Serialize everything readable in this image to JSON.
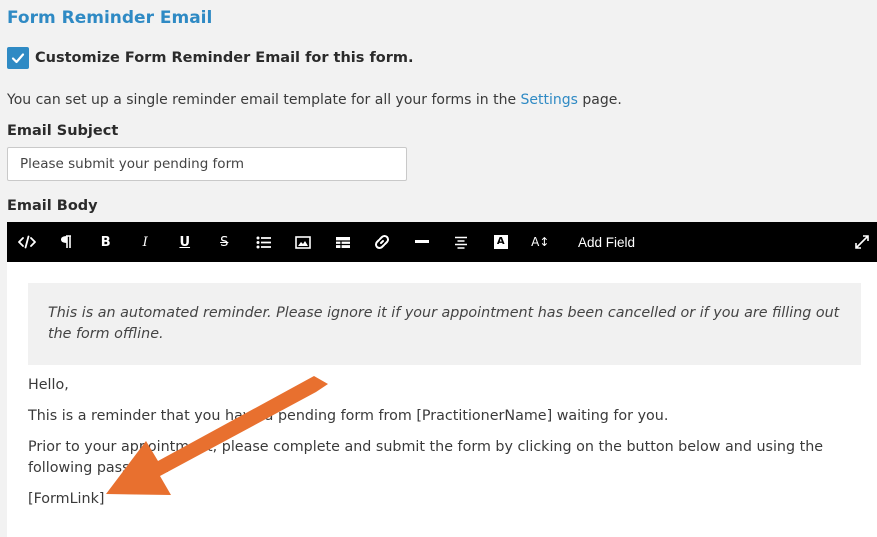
{
  "header": {
    "title": "Form Reminder Email",
    "customize_label": "Customize Form Reminder Email for this form.",
    "customize_checked": true
  },
  "info": {
    "prefix": "You can set up a single reminder email template for all your forms in the ",
    "link": "Settings",
    "suffix": " page."
  },
  "subject": {
    "label": "Email Subject",
    "value": "Please submit your pending form"
  },
  "body": {
    "label": "Email Body",
    "toolbar": {
      "icons": [
        "code-icon",
        "paragraph-icon",
        "bold-icon",
        "italic-icon",
        "underline-icon",
        "strikethrough-icon",
        "bullet-list-icon",
        "image-icon",
        "table-icon",
        "link-icon",
        "horizontal-rule-icon",
        "align-icon",
        "text-color-icon",
        "font-size-icon"
      ],
      "bold": "B",
      "italic": "I",
      "underline": "U",
      "strike": "S",
      "text_color": "A",
      "font_size": "A↕",
      "add_field": "Add Field"
    },
    "content": {
      "quote": "This is an automated reminder. Please ignore it if your appointment has been cancelled or if you are filling out the form offline.",
      "p1": "Hello,",
      "p2": "This is a reminder that you have a pending form from [PractitionerName] waiting for you.",
      "p3": "Prior to your appointment, please complete and submit the form by clicking on the button below and using the following password:",
      "p4": "[FormLink]"
    }
  },
  "colors": {
    "accent": "#2f8ac4",
    "arrow": "#e8702f",
    "toolbar": "#000000"
  }
}
